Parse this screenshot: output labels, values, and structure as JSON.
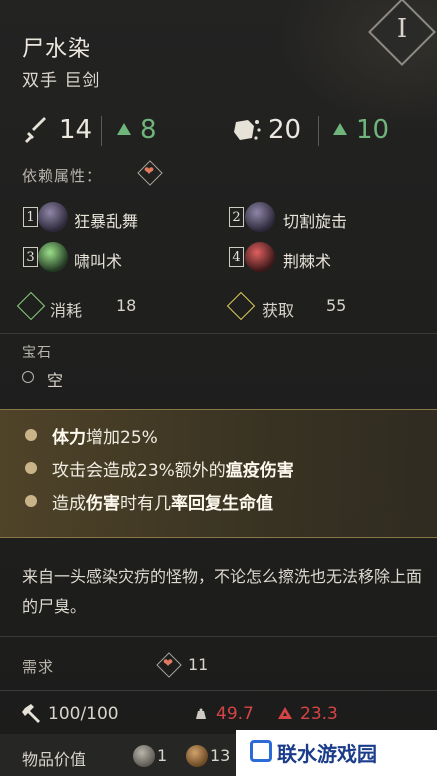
{
  "item": {
    "level": "I",
    "name": "尸水染",
    "type": "双手 巨剑",
    "physical_damage": "14",
    "physical_bonus": "8",
    "stagger_damage": "20",
    "stagger_bonus": "10"
  },
  "reliance": {
    "label": "依赖属性："
  },
  "skills": [
    {
      "num": "1",
      "name": "狂暴乱舞"
    },
    {
      "num": "2",
      "name": "切割旋击"
    },
    {
      "num": "3",
      "name": "啸叫术"
    },
    {
      "num": "4",
      "name": "荆棘术"
    }
  ],
  "costs": {
    "consume_label": "消耗",
    "consume_value": "18",
    "gain_label": "获取",
    "gain_value": "55"
  },
  "gem": {
    "section_label": "宝石",
    "slot_text": "空"
  },
  "effects": [
    {
      "bold": "体力",
      "text": "增加25%"
    },
    {
      "prefix": "攻击会造成23%额外的",
      "bold": "瘟疫伤害"
    },
    {
      "prefix": "造成",
      "bold1": "伤害",
      "mid": "时有几",
      "bold2": "率回复生命值"
    }
  ],
  "description": "来自一头感染灾疠的怪物，不论怎么擦洗也无法移除上面的尸臭。",
  "requirements": {
    "label": "需求",
    "value": "11"
  },
  "stats_bottom": {
    "durability": "100/100",
    "weight": "49.7",
    "limit": "23.3"
  },
  "value": {
    "label": "物品价值",
    "coin1": "1",
    "coin2": "13"
  },
  "watermark": {
    "text": "联水游戏园"
  },
  "colors": {
    "green": "#6fb57c",
    "red": "#d54545",
    "gold": "#8b7646"
  }
}
